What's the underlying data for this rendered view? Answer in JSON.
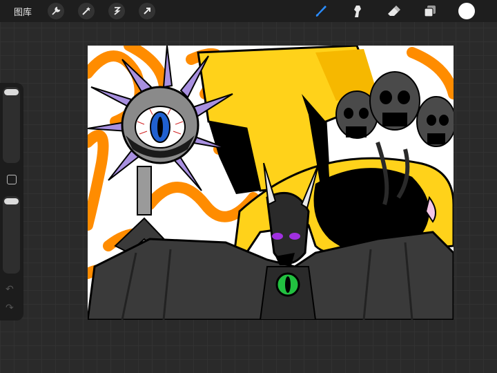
{
  "topbar": {
    "gallery_label": "图库",
    "tools_left": [
      "wrench-icon",
      "magic-wand-icon",
      "selection-icon",
      "transform-arrow-icon"
    ],
    "tools_right": [
      "brush-icon",
      "smudge-icon",
      "eraser-icon",
      "layers-icon"
    ],
    "active_tool": "brush",
    "current_color": "#ffffff",
    "accent_color": "#2a8cff"
  },
  "sidebar": {
    "brush_size_slider": {
      "level": 1.0
    },
    "opacity_slider": {
      "level": 1.0
    },
    "modify_button": "square-icon",
    "undo": "↶",
    "redo": "↷"
  },
  "artwork": {
    "description_colors": {
      "orange": "#ff8c00",
      "yellow": "#ffd21a",
      "black": "#000000",
      "gray": "#3a3a3a"
    }
  }
}
